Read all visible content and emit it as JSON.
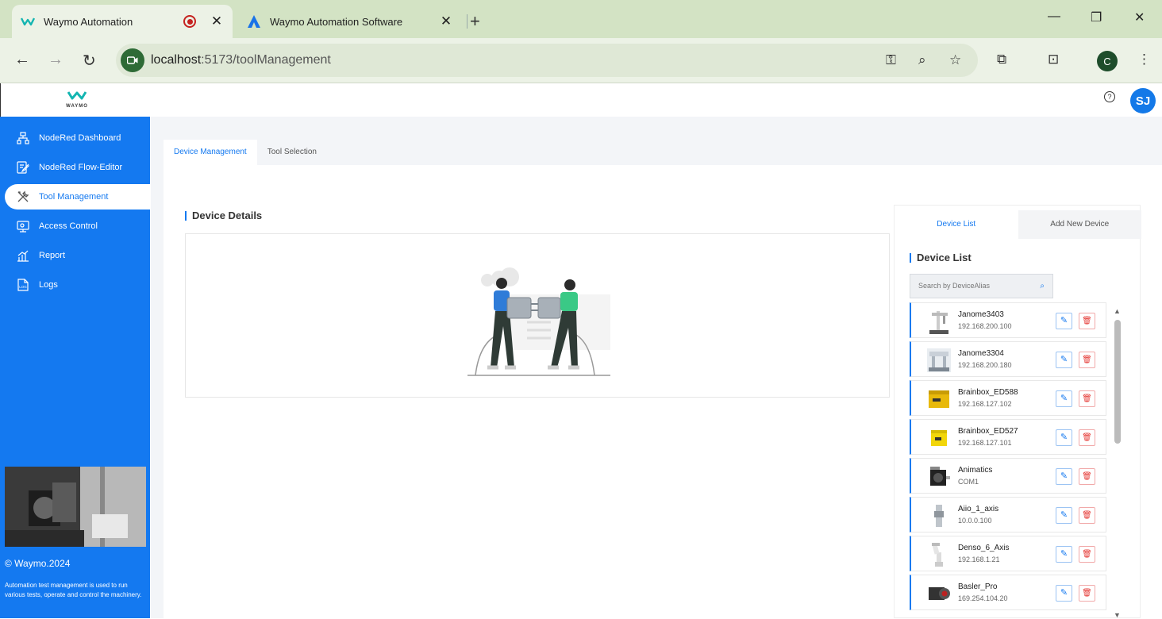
{
  "browser": {
    "tabs": [
      {
        "title": "Waymo Automation",
        "active": true
      },
      {
        "title": "Waymo Automation Software",
        "active": false
      }
    ],
    "url_host": "localhost",
    "url_rest": ":5173/toolManagement",
    "profile_initial": "C"
  },
  "app": {
    "logo_word": "WAYMO",
    "help_icon": "?",
    "user_initials": "SJ",
    "sidebar": {
      "items": [
        {
          "label": "NodeRed Dashboard",
          "icon": "dashboard-icon",
          "active": false
        },
        {
          "label": "NodeRed Flow-Editor",
          "icon": "flow-editor-icon",
          "active": false
        },
        {
          "label": "Tool Management",
          "icon": "tools-icon",
          "active": true
        },
        {
          "label": "Access Control",
          "icon": "access-control-icon",
          "active": false
        },
        {
          "label": "Report",
          "icon": "report-icon",
          "active": false
        },
        {
          "label": "Logs",
          "icon": "logs-icon",
          "active": false
        }
      ],
      "copyright": "© Waymo.2024",
      "blurb": "Automation test management is used to run various tests, operate and control the machinery."
    },
    "page_tabs": [
      {
        "label": "Device Management",
        "active": true
      },
      {
        "label": "Tool Selection",
        "active": false
      }
    ],
    "device_details_title": "Device Details",
    "right_tabs": [
      {
        "label": "Device List",
        "active": true
      },
      {
        "label": "Add New Device",
        "active": false
      }
    ],
    "device_list_title": "Device List",
    "search_placeholder": "Search by DeviceAlias",
    "devices": [
      {
        "name": "Janome3403",
        "ip": "192.168.200.100",
        "thumb": "robot-arm"
      },
      {
        "name": "Janome3304",
        "ip": "192.168.200.180",
        "thumb": "robot-desktop"
      },
      {
        "name": "Brainbox_ED588",
        "ip": "192.168.127.102",
        "thumb": "yellow-box"
      },
      {
        "name": "Brainbox_ED527",
        "ip": "192.168.127.101",
        "thumb": "yellow-box"
      },
      {
        "name": "Animatics",
        "ip": "COM1",
        "thumb": "motor"
      },
      {
        "name": "Aiio_1_axis",
        "ip": "10.0.0.100",
        "thumb": "linear-axis"
      },
      {
        "name": "Denso_6_Axis",
        "ip": "192.168.1.21",
        "thumb": "six-axis-arm"
      },
      {
        "name": "Basler_Pro",
        "ip": "169.254.104.20",
        "thumb": "camera"
      }
    ],
    "colors": {
      "primary": "#1479f0",
      "delete": "#e53935"
    }
  }
}
